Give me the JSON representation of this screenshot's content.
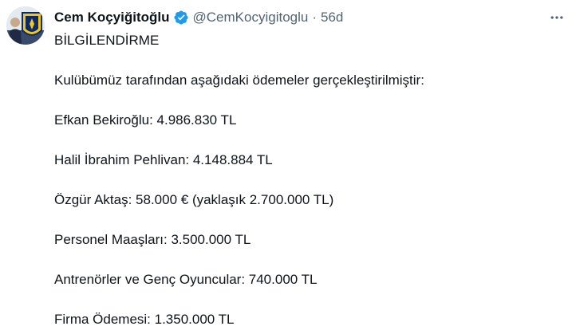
{
  "author": {
    "name": "Cem Koçyiğitoğlu",
    "handle": "@CemKocyigitoglu",
    "separator": "·",
    "time": "56d"
  },
  "icons": {
    "verified": "verified-badge-icon",
    "more": "more-horizontal-icon",
    "verified_color": "#1d9bf0"
  },
  "tweet": {
    "lines": [
      "BİLGİLENDİRME",
      "Kulübümüz tarafından aşağıdaki ödemeler gerçekleştirilmiştir:",
      "Efkan Bekiroğlu: 4.986.830 TL",
      "Halil İbrahim Pehlivan: 4.148.884 TL",
      "Özgür Aktaş: 58.000 € (yaklaşık 2.700.000 TL)",
      "Personel Maaşları: 3.500.000 TL",
      "Antrenörler ve Genç Oyuncular: 740.000 TL",
      "Firma Ödemesi: 1.350.000 TL"
    ]
  }
}
